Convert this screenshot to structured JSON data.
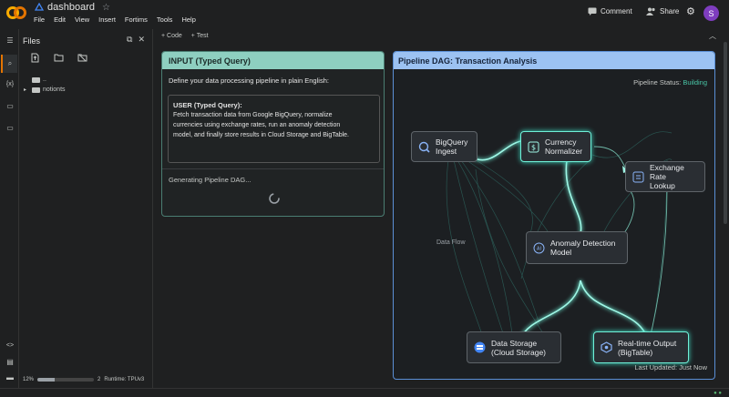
{
  "app": {
    "notebook_title": "dashboard",
    "menu": [
      "File",
      "Edit",
      "View",
      "Insert",
      "Fortims",
      "Tools",
      "Help"
    ],
    "comment_label": "Comment",
    "share_label": "Share",
    "avatar_letter": "S"
  },
  "files_panel": {
    "title": "Files",
    "tree": [
      {
        "label": ".."
      },
      {
        "label": "notionts"
      }
    ],
    "status": {
      "ram_label": "12%",
      "ram_fraction": 0.3,
      "count": "2",
      "runtime": "Runtime: TPUv3"
    }
  },
  "toolbar": {
    "code_label": "+ Code",
    "text_label": "+ Test"
  },
  "input_panel": {
    "header": "INPUT (Typed Query)",
    "prompt": "Define your data processing pipeline in plain English:",
    "query_title": "USER (Typed Query):",
    "query_lines": [
      "Fetch transaction data from Google BigQuery, normalize",
      "currencies using exchange rates, run an anomaly detection",
      "model, and finally store results in Cloud Storage and BigTable."
    ],
    "generating": "Generating Pipeline DAG..."
  },
  "dag_panel": {
    "header": "Pipeline DAG: Transaction Analysis",
    "status_prefix": "Pipeline Status: ",
    "status_value": "Building",
    "flow_label": "Data Flow",
    "last_updated": "Last Updated: Just Now",
    "nodes": {
      "bigquery": [
        "BigQuery",
        "Ingest"
      ],
      "currency": [
        "Currency",
        "Normalizer"
      ],
      "exchange": [
        "Exchange Rate",
        "Lookup"
      ],
      "anomaly": [
        "Anomaly Detection",
        "Model"
      ],
      "storage": [
        "Data Storage",
        "(Cloud Storage)"
      ],
      "realtime": [
        "Real-time Output",
        "(BigTable)"
      ]
    }
  },
  "colors": {
    "accent_teal": "#49c5a6",
    "input_header": "#8ecfc0",
    "dag_header": "#9cc2f2",
    "avatar": "#7e3dbf"
  }
}
